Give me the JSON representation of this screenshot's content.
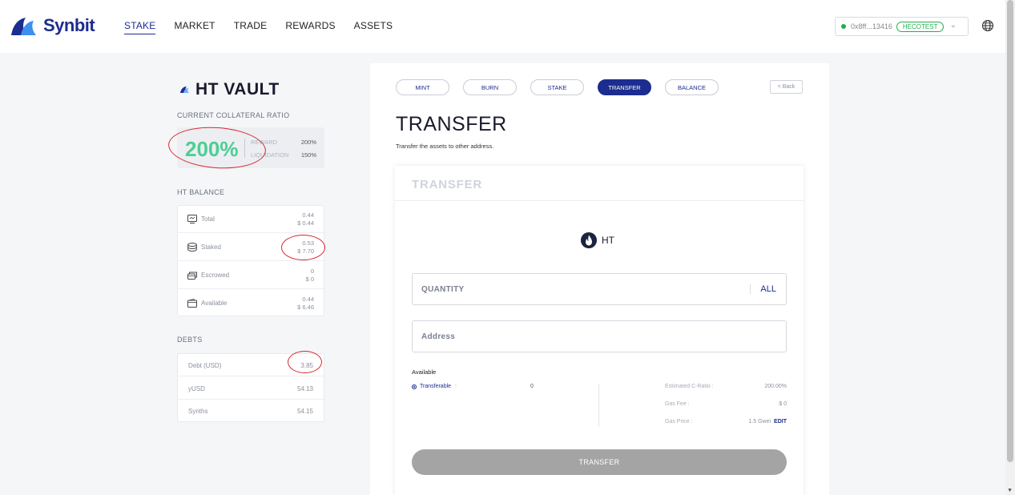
{
  "brand": {
    "name": "Synbit"
  },
  "nav": [
    {
      "label": "STAKE",
      "active": true
    },
    {
      "label": "MARKET",
      "active": false
    },
    {
      "label": "TRADE",
      "active": false
    },
    {
      "label": "REWARDS",
      "active": false
    },
    {
      "label": "ASSETS",
      "active": false
    }
  ],
  "wallet": {
    "address": "0x8ff...13416",
    "network": "HECOTEST",
    "status_color": "#21b04b"
  },
  "vault": {
    "title": "HT VAULT",
    "ratio_label": "CURRENT COLLATERAL RATIO",
    "ratio_value": "200%",
    "reward_label": "REWARD",
    "reward_value": "200%",
    "liquidation_label": "LIQUIDATION",
    "liquidation_value": "150%"
  },
  "balance": {
    "title": "HT BALANCE",
    "rows": [
      {
        "label": "Total",
        "amount": "0.44",
        "usd": "$ 0.44",
        "icon": "monitor-icon"
      },
      {
        "label": "Staked",
        "amount": "0.53",
        "usd": "$ 7.70",
        "icon": "database-icon"
      },
      {
        "label": "Escrowed",
        "amount": "0",
        "usd": "$ 0",
        "icon": "cards-icon"
      },
      {
        "label": "Available",
        "amount": "0.44",
        "usd": "$ 6.46",
        "icon": "wallet-icon"
      }
    ]
  },
  "debts": {
    "title": "DEBTS",
    "rows": [
      {
        "label": "Debt (USD)",
        "value": "3.85"
      },
      {
        "label": "yUSD",
        "value": "54.13"
      },
      {
        "label": "Synths",
        "value": "54.15"
      }
    ]
  },
  "tabs": [
    {
      "label": "MINT",
      "active": false
    },
    {
      "label": "BURN",
      "active": false
    },
    {
      "label": "STAKE",
      "active": false
    },
    {
      "label": "TRANSFER",
      "active": true
    },
    {
      "label": "BALANCE",
      "active": false
    }
  ],
  "back_label": "< Back",
  "page": {
    "title": "TRANSFER",
    "description": "Transfer the assets to other address."
  },
  "form": {
    "header": "TRANSFER",
    "token": "HT",
    "quantity_label": "QUANTITY",
    "all_label": "ALL",
    "address_label": "Address",
    "available_label": "Available",
    "transferable_label": "Transferable",
    "transferable_colon": ":",
    "transferable_value": "0",
    "est_ratio_label": "Estimated C-Ratio :",
    "est_ratio_value": "200.00%",
    "gas_fee_label": "Gas Fee :",
    "gas_fee_value": "$ 0",
    "gas_price_label": "Gas Price :",
    "gas_price_value": "1.5 Gwei",
    "edit_label": "EDIT",
    "submit_label": "TRANSFER"
  },
  "colors": {
    "primary": "#1c2d8f",
    "ratio": "#4ccf93",
    "annotation": "#d8262e",
    "submit_disabled": "#a4a4a4"
  }
}
